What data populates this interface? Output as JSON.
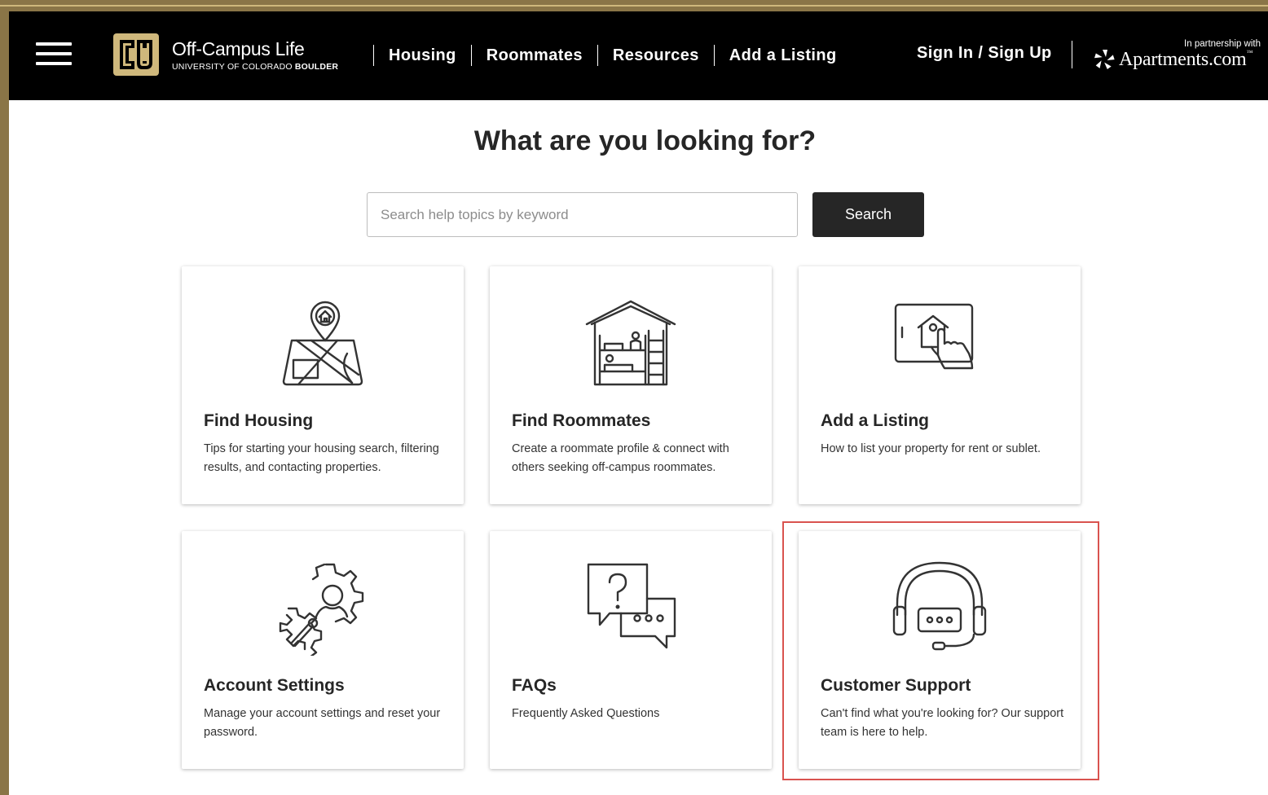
{
  "header": {
    "site_title": "Off-Campus Life",
    "site_subtitle_prefix": "UNIVERSITY OF COLORADO",
    "site_subtitle_bold": "BOULDER",
    "nav": [
      "Housing",
      "Roommates",
      "Resources",
      "Add a Listing"
    ],
    "signin_label": "Sign In / Sign Up",
    "partner_note": "In partnership with",
    "partner_name": "Apartments.com",
    "partner_tm": "™"
  },
  "main": {
    "title": "What are you looking for?",
    "search": {
      "placeholder": "Search help topics by keyword",
      "value": "",
      "button_label": "Search"
    },
    "cards": [
      {
        "title": "Find Housing",
        "description": "Tips for starting your housing search, filtering results, and contacting properties.",
        "icon": "map-pin-house-icon"
      },
      {
        "title": "Find Roommates",
        "description": "Create a roommate profile & connect with others seeking off-campus roommates.",
        "icon": "bunk-bed-house-icon"
      },
      {
        "title": "Add a Listing",
        "description": "How to list your property for rent or sublet.",
        "icon": "tablet-house-hand-icon"
      },
      {
        "title": "Account Settings",
        "description": "Manage your account settings and reset your password.",
        "icon": "gear-user-wrench-icon"
      },
      {
        "title": "FAQs",
        "description": "Frequently Asked Questions",
        "icon": "question-chat-bubbles-icon"
      },
      {
        "title": "Customer Support",
        "description": "Can't find what you're looking for? Our support team is here to help.",
        "icon": "headset-icon"
      }
    ]
  },
  "colors": {
    "header_bg": "#000000",
    "brand_gold": "#cfb87c",
    "frame_gold": "#8a7547",
    "search_button_bg": "#262626",
    "highlight_border": "#d9534f"
  }
}
